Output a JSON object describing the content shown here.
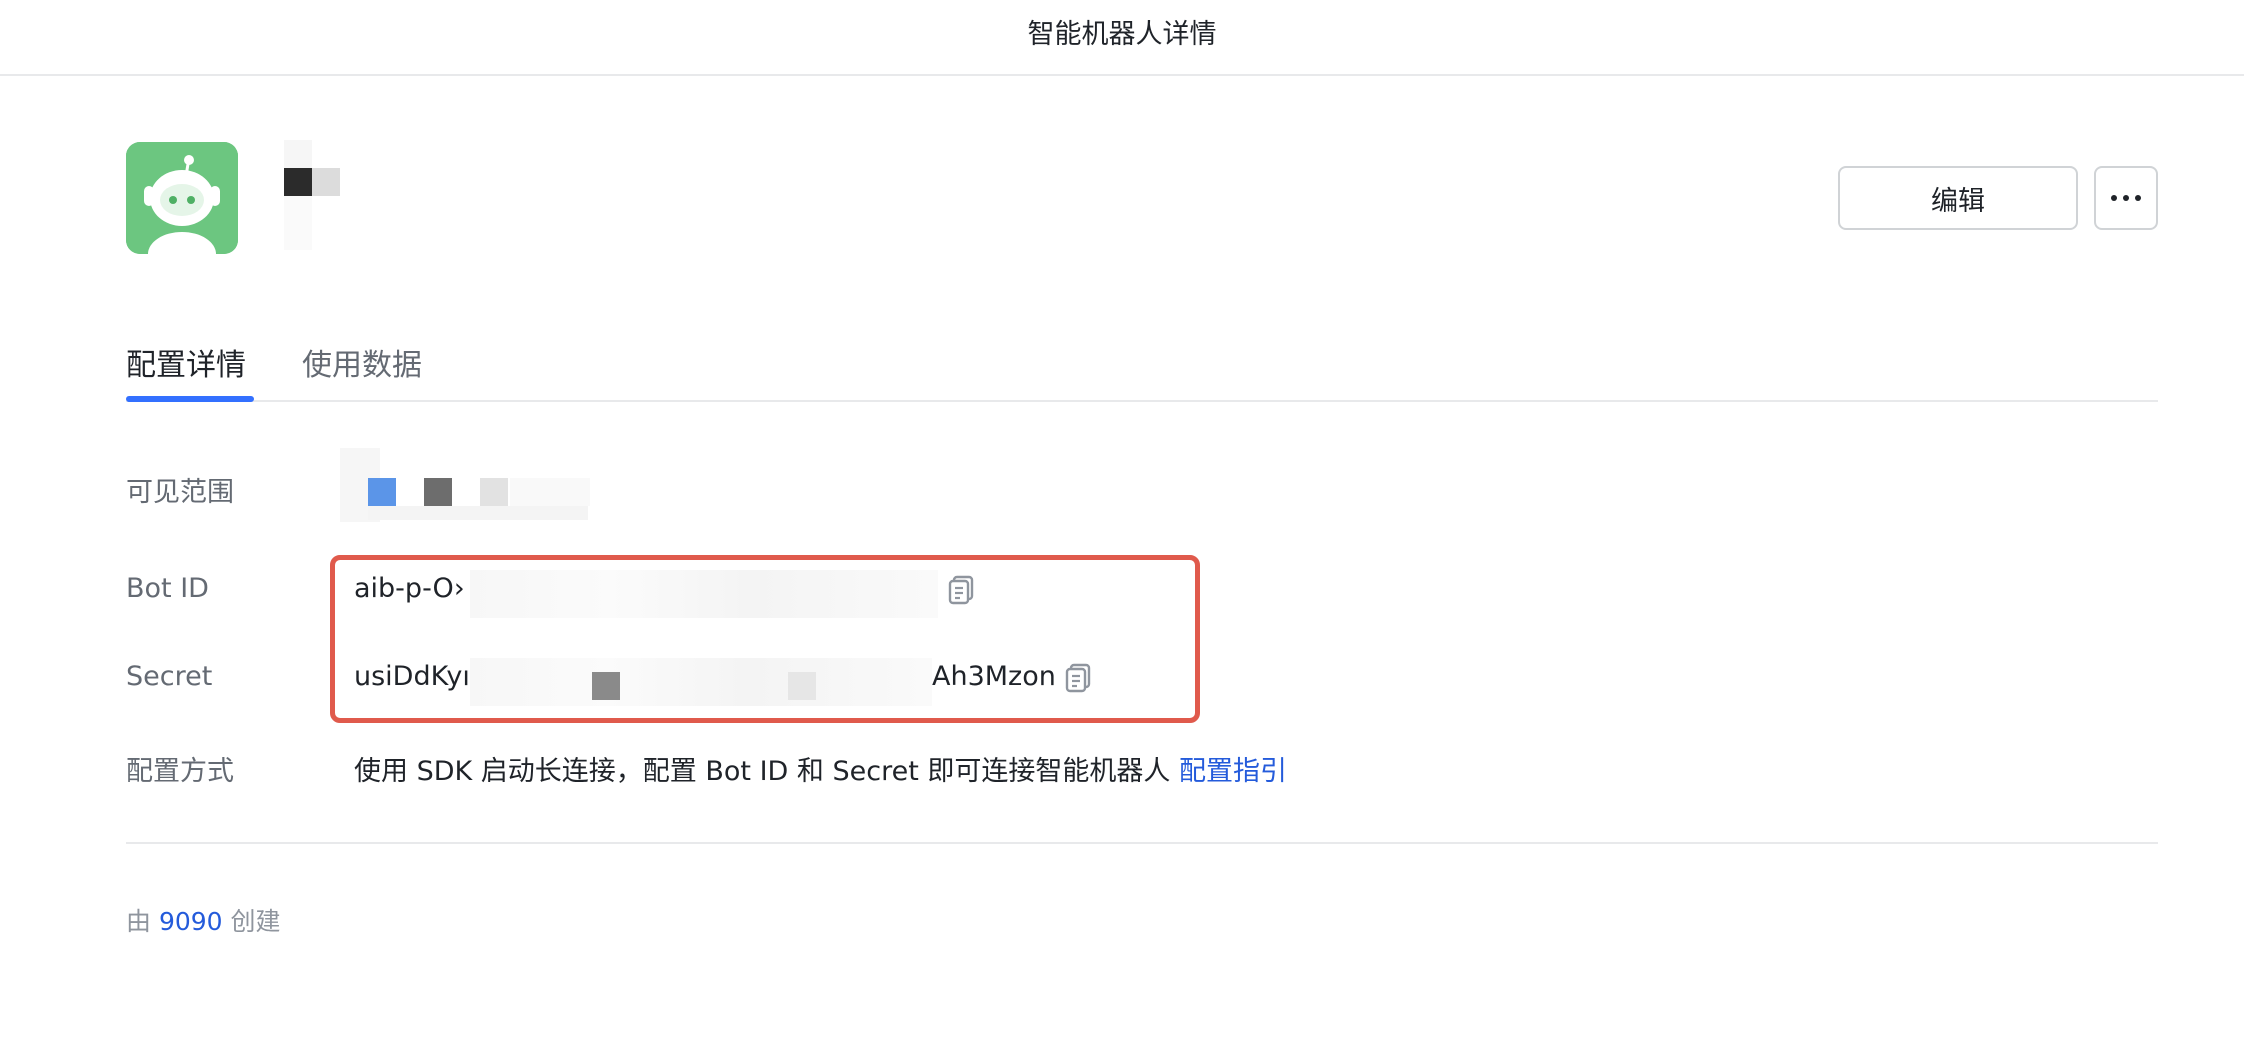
{
  "window": {
    "title": "智能机器人详情"
  },
  "bot": {
    "avatar_icon": "robot-avatar-icon",
    "avatar_color": "#6cc680"
  },
  "actions": {
    "edit_label": "编辑",
    "more_icon": "more-dots-icon"
  },
  "tabs": [
    {
      "label": "配置详情",
      "active": true
    },
    {
      "label": "使用数据",
      "active": false
    }
  ],
  "fields": {
    "visibility": {
      "label": "可见范围"
    },
    "bot_id": {
      "label": "Bot ID",
      "value_prefix": "aib-p-O›"
    },
    "secret": {
      "label": "Secret",
      "value_prefix": "usiDdKyı",
      "value_suffix": "Ah3Mzon"
    },
    "config_method": {
      "label": "配置方式",
      "description": "使用 SDK 启动长连接，配置 Bot ID 和 Secret 即可连接智能机器人",
      "link_text": "配置指引"
    }
  },
  "footer": {
    "prefix": "由",
    "creator": "9090",
    "suffix": "创建"
  },
  "colors": {
    "accent": "#3370ff",
    "link": "#245bdb",
    "highlight": "#e05a4c"
  }
}
